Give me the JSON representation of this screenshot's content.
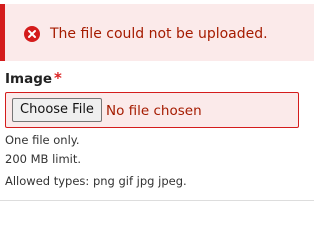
{
  "error": {
    "message": "The file could not be uploaded.",
    "icon": "error-circle-x-icon",
    "background_color": "#fbeaea",
    "accent_color": "#d41c1c",
    "text_color": "#a51b00"
  },
  "field": {
    "label": "Image",
    "required_marker": "*",
    "choose_button_label": "Choose File",
    "status_text": "No file chosen",
    "descriptions": [
      "One file only.",
      "200 MB limit.",
      "Allowed types: png gif jpg jpeg."
    ]
  }
}
